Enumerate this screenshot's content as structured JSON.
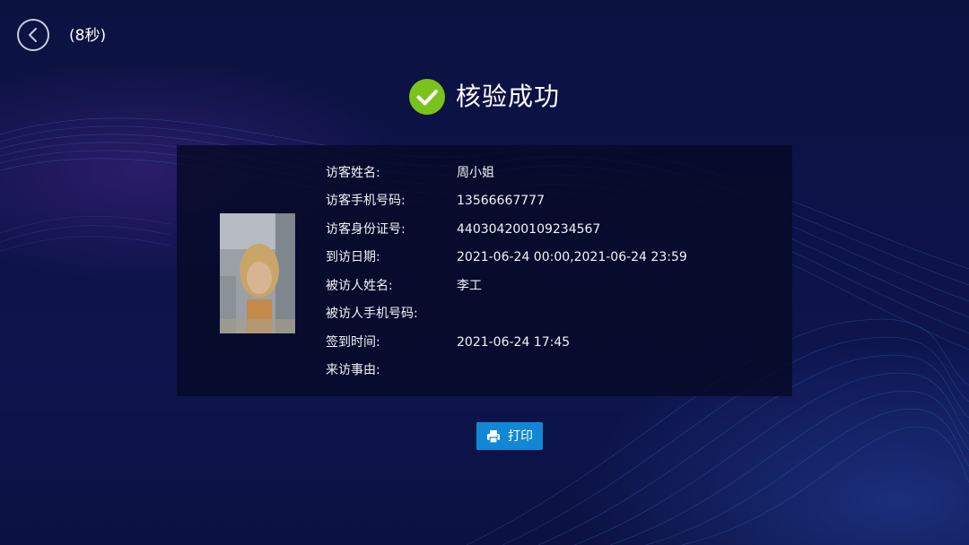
{
  "header": {
    "countdown": "(8秒)",
    "back_icon": "chevron-left-icon"
  },
  "status": {
    "icon": "check-circle-icon",
    "icon_color": "#7ac31c",
    "text": "核验成功"
  },
  "visitor": {
    "rows": [
      {
        "label": "访客姓名:",
        "value": "周小姐"
      },
      {
        "label": "访客手机号码:",
        "value": "13566667777"
      },
      {
        "label": "访客身份证号:",
        "value": "440304200109234567"
      },
      {
        "label": "到访日期:",
        "value": "2021-06-24 00:00,2021-06-24 23:59"
      },
      {
        "label": "被访人姓名:",
        "value": "李工"
      },
      {
        "label": "被访人手机号码:",
        "value": ""
      },
      {
        "label": "签到时间:",
        "value": "2021-06-24 17:45"
      },
      {
        "label": "来访事由:",
        "value": ""
      }
    ]
  },
  "actions": {
    "print_label": "打印",
    "print_icon": "printer-icon",
    "print_color": "#1287d6"
  }
}
